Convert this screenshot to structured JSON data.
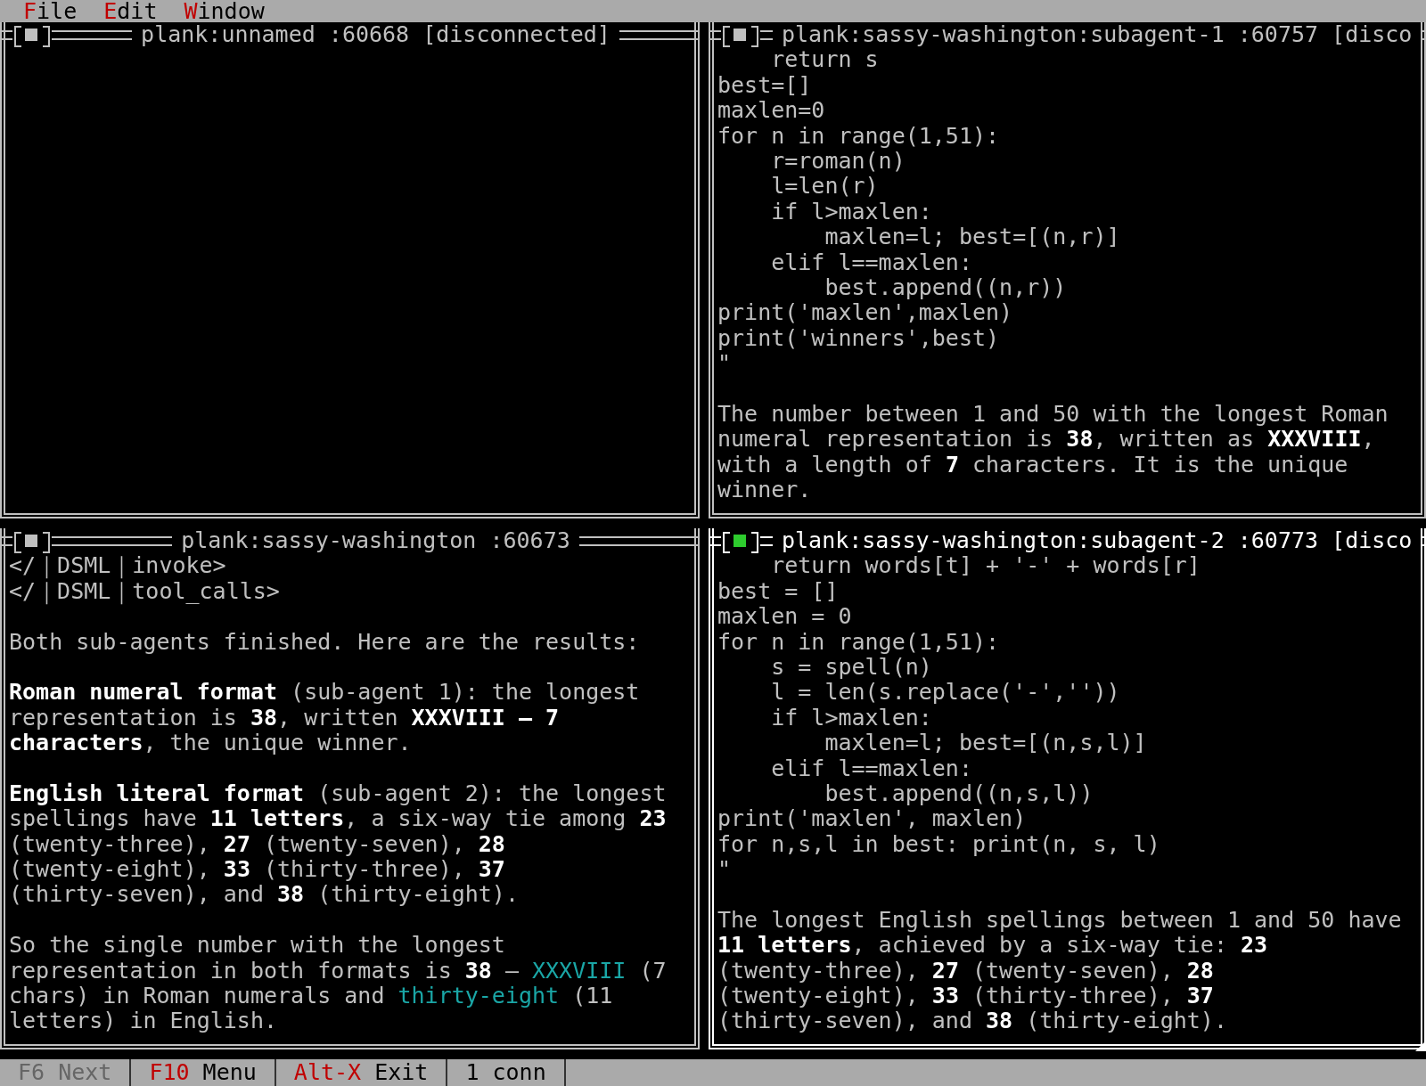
{
  "menu_bar": [
    {
      "hotkey": "F",
      "rest": "ile"
    },
    {
      "hotkey": "E",
      "rest": "dit"
    },
    {
      "hotkey": "W",
      "rest": "indow"
    }
  ],
  "windows": [
    {
      "title": "plank:unnamed :60668 [disconnected]",
      "active": false
    },
    {
      "title": "plank:sassy-washington:subagent-1 :60757 [disco",
      "active": false,
      "blocks": [
        {
          "lines": [
            "    return s",
            "best=[]",
            "maxlen=0",
            "for n in range(1,51):",
            "    r=roman(n)",
            "    l=len(r)",
            "    if l>maxlen:",
            "        maxlen=l; best=[(n,r)]",
            "    elif l==maxlen:",
            "        best.append((n,r))",
            "print('maxlen',maxlen)",
            "print('winners',best)",
            "\""
          ]
        },
        {
          "lines": [
            "The number between 1 and 50 with the longest Roman",
            "numeral representation is **38**, written as **XXXVIII**,",
            "with a length of **7** characters. It is the unique",
            "winner."
          ]
        }
      ]
    },
    {
      "title": "plank:sassy-washington :60673",
      "active": false,
      "blocks": [
        {
          "lines": [
            "</｜DSML｜invoke>",
            "</｜DSML｜tool_calls>"
          ]
        },
        {
          "lines": [
            "Both sub-agents finished. Here are the results:"
          ]
        },
        {
          "lines": [
            "**Roman numeral format** (sub-agent 1): the longest",
            "representation is **38**, written **XXXVIII — 7**",
            "**characters**, the unique winner."
          ]
        },
        {
          "lines": [
            "**English literal format** (sub-agent 2): the longest",
            "spellings have **11 letters**, a six-way tie among **23**",
            "(twenty-three), **27** (twenty-seven), **28**",
            "(twenty-eight), **33** (thirty-three), **37**",
            "(thirty-seven), and **38** (thirty-eight)."
          ]
        },
        {
          "lines": [
            "So the single number with the longest",
            [
              {
                "text": "representation in both formats is **38** — "
              },
              {
                "text": "XXXVIII",
                "color": "#1aa6a6"
              },
              {
                "text": " (7"
              }
            ],
            [
              {
                "text": "chars) in Roman numerals and "
              },
              {
                "text": "thirty-eight",
                "color": "#1aa6a6"
              },
              {
                "text": " (11"
              }
            ],
            "letters) in English."
          ]
        }
      ]
    },
    {
      "title": "plank:sassy-washington:subagent-2 :60773 [disco",
      "active": true,
      "blocks": [
        {
          "lines": [
            "    return words[t] + '-' + words[r]",
            "best = []",
            "maxlen = 0",
            "for n in range(1,51):",
            "    s = spell(n)",
            "    l = len(s.replace('-',''))",
            "    if l>maxlen:",
            "        maxlen=l; best=[(n,s,l)]",
            "    elif l==maxlen:",
            "        best.append((n,s,l))",
            "print('maxlen', maxlen)",
            "for n,s,l in best: print(n, s, l)",
            "\""
          ]
        },
        {
          "lines": [
            "The longest English spellings between 1 and 50 have",
            "**11 letters**, achieved by a six-way tie: **23**",
            "(twenty-three), **27** (twenty-seven), **28**",
            "(twenty-eight), **33** (thirty-three), **37**",
            "(thirty-seven), and **38** (thirty-eight)."
          ]
        }
      ]
    }
  ],
  "status_bar": [
    {
      "key": "F6",
      "label": "Next",
      "disabled": true
    },
    {
      "key": "F10",
      "label": "Menu",
      "disabled": false
    },
    {
      "key": "Alt-X",
      "label": "Exit",
      "disabled": false
    },
    {
      "label": "1 conn",
      "disabled": false
    }
  ]
}
